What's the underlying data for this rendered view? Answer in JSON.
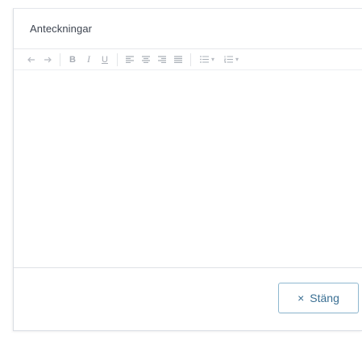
{
  "dialog": {
    "title": "Anteckningar"
  },
  "toolbar": {
    "undo_icon": "undo-icon",
    "redo_icon": "redo-icon",
    "bold_label": "B",
    "italic_label": "I",
    "underline_label": "U",
    "align_icons": [
      "align-left-icon",
      "align-center-icon",
      "align-right-icon",
      "align-justify-icon"
    ],
    "list_icons": [
      "bullet-list-icon",
      "numbered-list-icon"
    ],
    "dropdown_glyph": "▾"
  },
  "editor": {
    "content": ""
  },
  "footer": {
    "close_icon": "×",
    "close_label": "Stäng"
  },
  "colors": {
    "accent": "#3a6f93",
    "button_border": "#8fb8d0",
    "toolbar_icon": "#a8adb5",
    "title_text": "#3d4450"
  }
}
